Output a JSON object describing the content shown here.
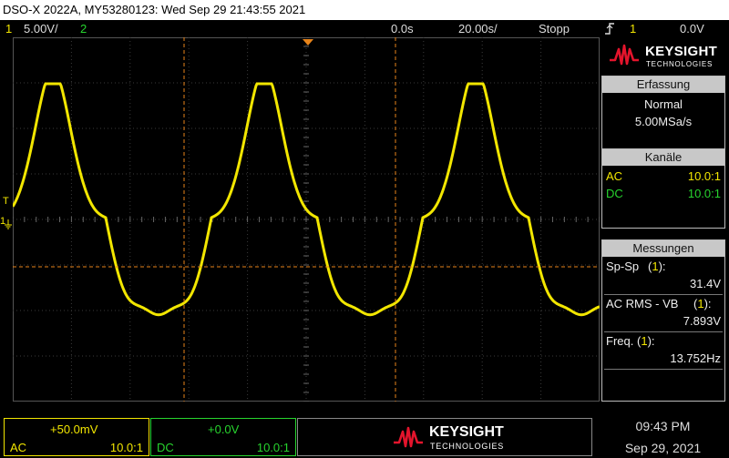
{
  "title_bar": {
    "text": "DSO-X 2022A, MY53280123: Wed Sep 29 21:43:55 2021"
  },
  "top_bar": {
    "ch1_num": "1",
    "ch1_scale": "5.00V/",
    "ch2_num": "2",
    "time_offset": "0.0s",
    "time_scale": "20.00s/",
    "run_state": "Stopp",
    "trigger_icon": "trigger-edge-icon",
    "trigger_source": "1",
    "trigger_level": "0.0V"
  },
  "side_panel": {
    "logo_text_1": "KEYSIGHT",
    "logo_text_2": "TECHNOLOGIES",
    "acquisition": {
      "title": "Erfassung",
      "mode": "Normal",
      "rate": "5.00MSa/s"
    },
    "channels": {
      "title": "Kanäle",
      "rows": [
        {
          "coupling": "AC",
          "probe": "10.0:1"
        },
        {
          "coupling": "DC",
          "probe": "10.0:1"
        }
      ]
    },
    "measurements": {
      "title": "Messungen",
      "items": [
        {
          "label": "Sp-Sp",
          "src": "1",
          "value": "31.4V"
        },
        {
          "label": "AC RMS - VB",
          "src": "1",
          "value": "7.893V"
        },
        {
          "label": "Freq.",
          "src": "1",
          "value": "13.752Hz"
        }
      ]
    }
  },
  "plot": {
    "ch1_marker": "1",
    "trigger_marker": "T"
  },
  "bottom_bar": {
    "ch1": {
      "offset": "+50.0mV",
      "coupling": "AC",
      "probe": "10.0:1"
    },
    "ch2": {
      "offset": "+0.0V",
      "coupling": "DC",
      "probe": "10.0:1"
    },
    "logo_text_1": "KEYSIGHT",
    "logo_text_2": "TECHNOLOGIES",
    "time": "09:43 PM",
    "date": "Sep 29, 2021"
  },
  "colors": {
    "ch1": "#f2e600",
    "ch2": "#27d42e",
    "cursor": "#e8841a",
    "grid": "#3a3a3a"
  }
}
